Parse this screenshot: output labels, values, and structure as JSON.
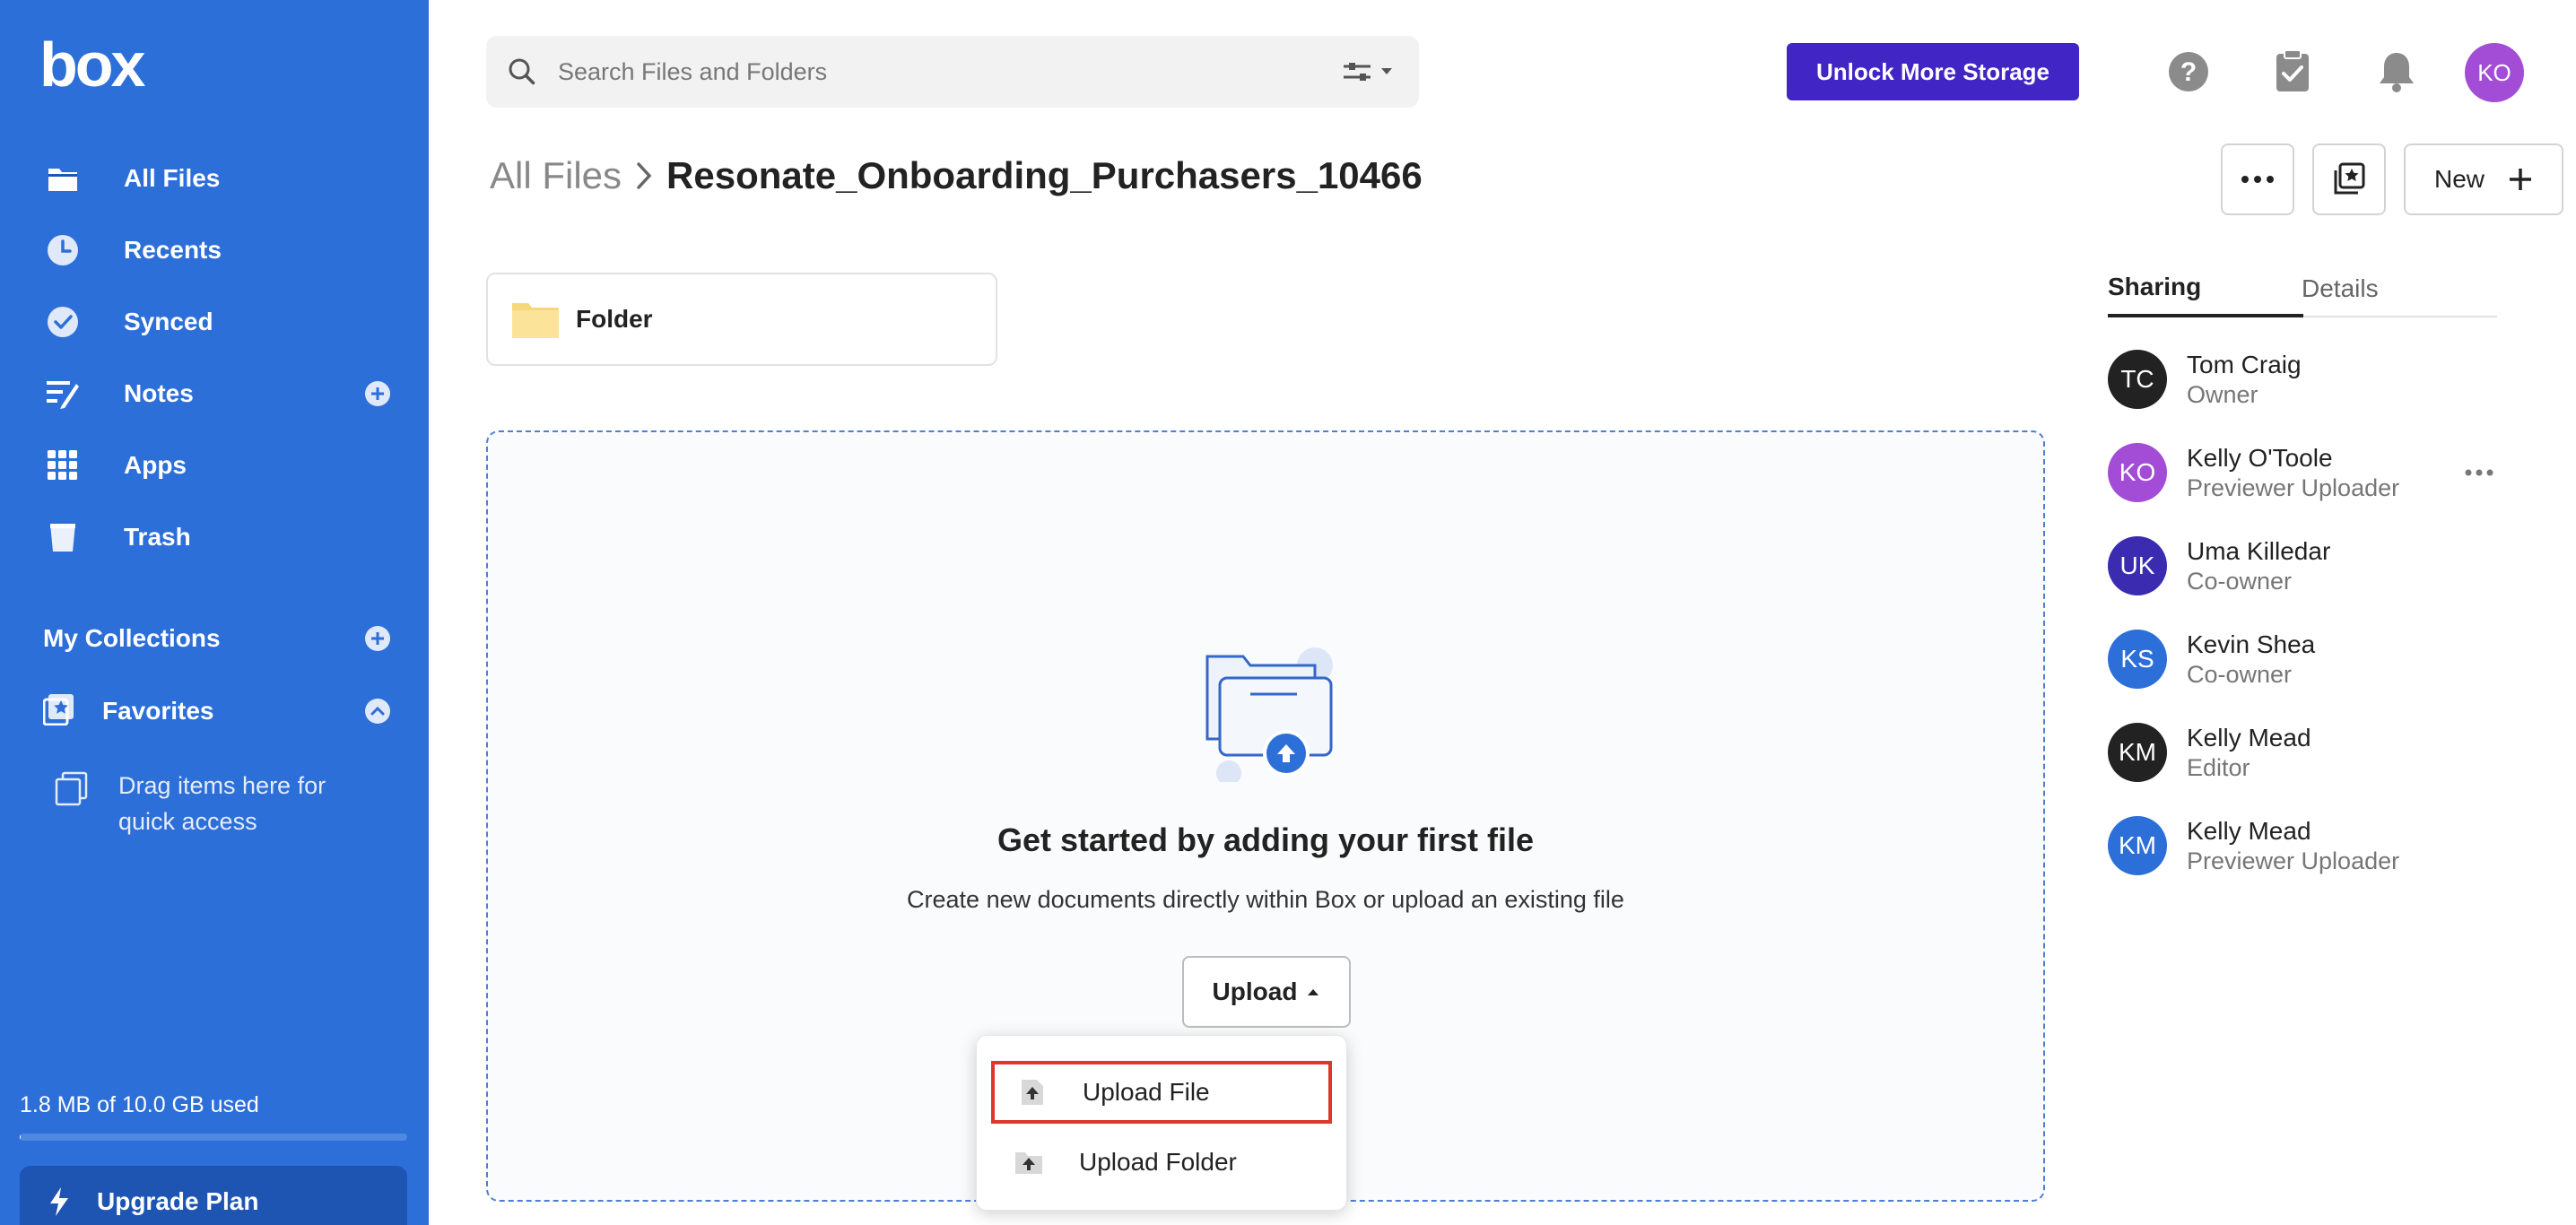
{
  "brand": {
    "logo_text": "box",
    "accent": "#2d6fd8",
    "purple": "#4126c5"
  },
  "sidebar": {
    "items": [
      {
        "label": "All Files",
        "icon": "folder-icon",
        "active": true
      },
      {
        "label": "Recents",
        "icon": "clock-icon"
      },
      {
        "label": "Synced",
        "icon": "check-circle-icon"
      },
      {
        "label": "Notes",
        "icon": "notes-icon",
        "has_add": true
      },
      {
        "label": "Apps",
        "icon": "grid-icon"
      },
      {
        "label": "Trash",
        "icon": "trash-icon"
      }
    ],
    "collections_label": "My Collections",
    "favorites_label": "Favorites",
    "drag_hint": "Drag items here for quick access",
    "storage_text": "1.8 MB of 10.0 GB used",
    "storage_fraction": 0.0002,
    "upgrade_label": "Upgrade Plan"
  },
  "topbar": {
    "search_placeholder": "Search Files and Folders",
    "unlock_label": "Unlock More Storage",
    "user_initials": "KO",
    "user_color": "#a34dd7"
  },
  "breadcrumb": {
    "root": "All Files",
    "current": "Resonate_Onboarding_Purchasers_10466"
  },
  "header_actions": {
    "new_label": "New"
  },
  "folder": {
    "label": "Folder"
  },
  "dropzone": {
    "title": "Get started by adding your first file",
    "subtitle": "Create new documents directly within Box or upload an existing file",
    "upload_label": "Upload"
  },
  "upload_menu": {
    "items": [
      {
        "label": "Upload File",
        "selected": true
      },
      {
        "label": "Upload Folder",
        "selected": false
      }
    ]
  },
  "panel": {
    "tabs": [
      {
        "label": "Sharing",
        "active": true
      },
      {
        "label": "Details",
        "active": false
      }
    ],
    "people": [
      {
        "initials": "TC",
        "name": "Tom Craig",
        "role": "Owner",
        "color": "#222222"
      },
      {
        "initials": "KO",
        "name": "Kelly O'Toole",
        "role": "Previewer Uploader",
        "color": "#a34dd7",
        "more": true
      },
      {
        "initials": "UK",
        "name": "Uma Killedar",
        "role": "Co-owner",
        "color": "#3a2bb0"
      },
      {
        "initials": "KS",
        "name": "Kevin Shea",
        "role": "Co-owner",
        "color": "#2d6fd8"
      },
      {
        "initials": "KM",
        "name": "Kelly Mead",
        "role": "Editor",
        "color": "#222222"
      },
      {
        "initials": "KM",
        "name": "Kelly Mead",
        "role": "Previewer Uploader",
        "color": "#2d6fd8"
      }
    ]
  }
}
